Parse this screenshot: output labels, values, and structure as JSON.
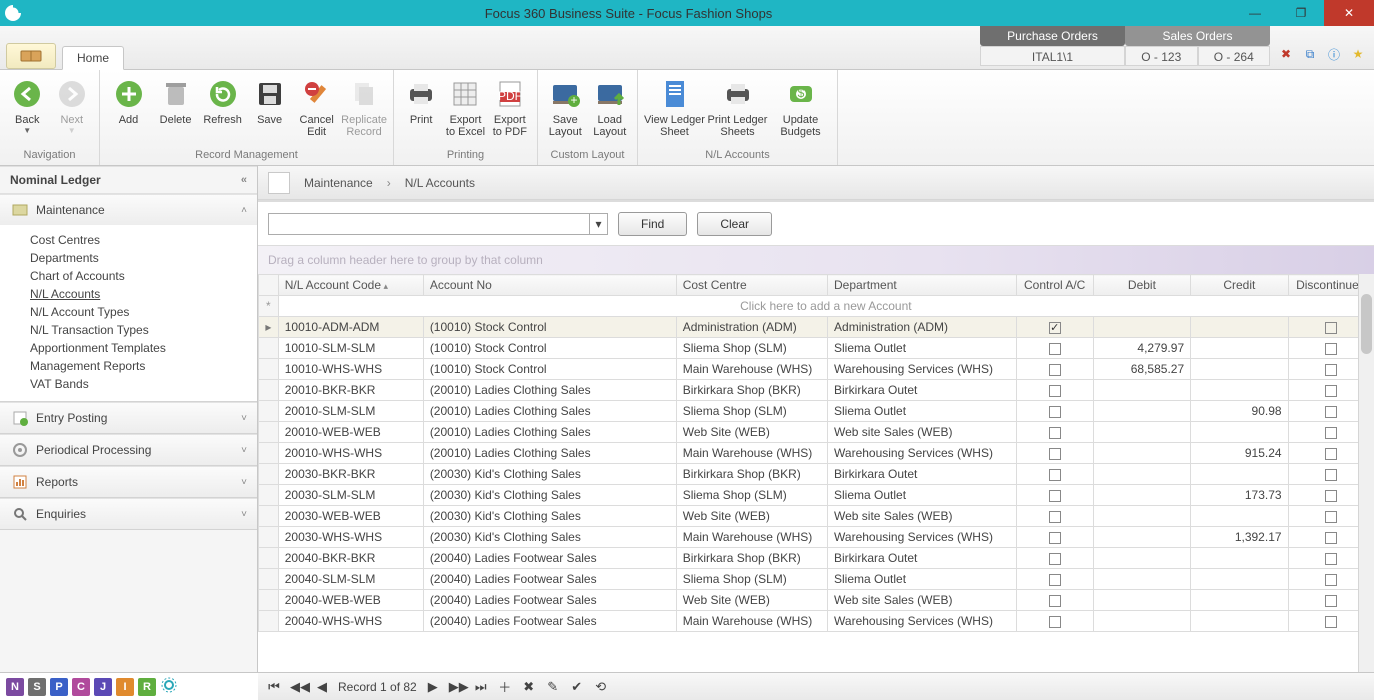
{
  "window": {
    "title": "Focus 360 Business Suite - Focus Fashion Shops"
  },
  "orders": {
    "purchase": {
      "label": "Purchase Orders",
      "cells": [
        "ITAL1\\1"
      ]
    },
    "sales": {
      "label": "Sales Orders",
      "cells": [
        "O - 123",
        "O - 264"
      ]
    }
  },
  "ribbon": {
    "home_tab": "Home",
    "groups": {
      "navigation": {
        "label": "Navigation",
        "back": "Back",
        "next": "Next"
      },
      "record": {
        "label": "Record Management",
        "add": "Add",
        "delete": "Delete",
        "refresh": "Refresh",
        "save": "Save",
        "cancel": "Cancel\nEdit",
        "replicate": "Replicate\nRecord"
      },
      "printing": {
        "label": "Printing",
        "print": "Print",
        "excel": "Export\nto Excel",
        "pdf": "Export\nto PDF"
      },
      "layout": {
        "label": "Custom Layout",
        "save": "Save\nLayout",
        "load": "Load\nLayout"
      },
      "nl": {
        "label": "N/L Accounts",
        "view": "View Ledger\nSheet",
        "print": "Print Ledger\nSheets",
        "update": "Update\nBudgets"
      }
    }
  },
  "sidebar": {
    "title": "Nominal Ledger",
    "sections": {
      "maintenance": {
        "label": "Maintenance",
        "items": [
          "Cost Centres",
          "Departments",
          "Chart of Accounts",
          "N/L Accounts",
          "N/L Account Types",
          "N/L Transaction Types",
          "Apportionment Templates",
          "Management Reports",
          "VAT Bands"
        ],
        "active_index": 3
      },
      "entry": {
        "label": "Entry Posting"
      },
      "periodical": {
        "label": "Periodical Processing"
      },
      "reports": {
        "label": "Reports"
      },
      "enquiries": {
        "label": "Enquiries"
      }
    }
  },
  "breadcrumb": {
    "a": "Maintenance",
    "b": "N/L Accounts"
  },
  "findbar": {
    "find": "Find",
    "clear": "Clear"
  },
  "groupbar": "Drag a column header here to group by that column",
  "grid": {
    "columns": [
      "N/L Account Code",
      "Account No",
      "Cost Centre",
      "Department",
      "Control A/C",
      "Debit",
      "Credit",
      "Discontinued"
    ],
    "addrow_text": "Click here to add a new Account",
    "rows": [
      {
        "code": "10010-ADM-ADM",
        "acc": "(10010) Stock Control",
        "cc": "Administration (ADM)",
        "dept": "Administration (ADM)",
        "ctrl": true,
        "debit": "",
        "credit": "",
        "disc": false,
        "sel": true
      },
      {
        "code": "10010-SLM-SLM",
        "acc": "(10010) Stock Control",
        "cc": "Sliema Shop (SLM)",
        "dept": "Sliema Outlet",
        "ctrl": false,
        "debit": "4,279.97",
        "credit": "",
        "disc": false
      },
      {
        "code": "10010-WHS-WHS",
        "acc": "(10010) Stock Control",
        "cc": "Main Warehouse (WHS)",
        "dept": "Warehousing Services (WHS)",
        "ctrl": false,
        "debit": "68,585.27",
        "credit": "",
        "disc": false
      },
      {
        "code": "20010-BKR-BKR",
        "acc": "(20010) Ladies Clothing Sales",
        "cc": "Birkirkara Shop (BKR)",
        "dept": "Birkirkara Outet",
        "ctrl": false,
        "debit": "",
        "credit": "",
        "disc": false
      },
      {
        "code": "20010-SLM-SLM",
        "acc": "(20010) Ladies Clothing Sales",
        "cc": "Sliema Shop (SLM)",
        "dept": "Sliema Outlet",
        "ctrl": false,
        "debit": "",
        "credit": "90.98",
        "disc": false
      },
      {
        "code": "20010-WEB-WEB",
        "acc": "(20010) Ladies Clothing Sales",
        "cc": "Web Site (WEB)",
        "dept": "Web site Sales (WEB)",
        "ctrl": false,
        "debit": "",
        "credit": "",
        "disc": false
      },
      {
        "code": "20010-WHS-WHS",
        "acc": "(20010) Ladies Clothing Sales",
        "cc": "Main Warehouse (WHS)",
        "dept": "Warehousing Services (WHS)",
        "ctrl": false,
        "debit": "",
        "credit": "915.24",
        "disc": false
      },
      {
        "code": "20030-BKR-BKR",
        "acc": "(20030) Kid's Clothing Sales",
        "cc": "Birkirkara Shop (BKR)",
        "dept": "Birkirkara Outet",
        "ctrl": false,
        "debit": "",
        "credit": "",
        "disc": false
      },
      {
        "code": "20030-SLM-SLM",
        "acc": "(20030) Kid's Clothing Sales",
        "cc": "Sliema Shop (SLM)",
        "dept": "Sliema Outlet",
        "ctrl": false,
        "debit": "",
        "credit": "173.73",
        "disc": false
      },
      {
        "code": "20030-WEB-WEB",
        "acc": "(20030) Kid's Clothing Sales",
        "cc": "Web Site (WEB)",
        "dept": "Web site Sales (WEB)",
        "ctrl": false,
        "debit": "",
        "credit": "",
        "disc": false
      },
      {
        "code": "20030-WHS-WHS",
        "acc": "(20030) Kid's Clothing Sales",
        "cc": "Main Warehouse (WHS)",
        "dept": "Warehousing Services (WHS)",
        "ctrl": false,
        "debit": "",
        "credit": "1,392.17",
        "disc": false
      },
      {
        "code": "20040-BKR-BKR",
        "acc": "(20040) Ladies Footwear Sales",
        "cc": "Birkirkara Shop (BKR)",
        "dept": "Birkirkara Outet",
        "ctrl": false,
        "debit": "",
        "credit": "",
        "disc": false
      },
      {
        "code": "20040-SLM-SLM",
        "acc": "(20040) Ladies Footwear Sales",
        "cc": "Sliema Shop (SLM)",
        "dept": "Sliema Outlet",
        "ctrl": false,
        "debit": "",
        "credit": "",
        "disc": false
      },
      {
        "code": "20040-WEB-WEB",
        "acc": "(20040) Ladies Footwear Sales",
        "cc": "Web Site (WEB)",
        "dept": "Web site Sales (WEB)",
        "ctrl": false,
        "debit": "",
        "credit": "",
        "disc": false
      },
      {
        "code": "20040-WHS-WHS",
        "acc": "(20040) Ladies Footwear Sales",
        "cc": "Main Warehouse (WHS)",
        "dept": "Warehousing Services (WHS)",
        "ctrl": false,
        "debit": "",
        "credit": "",
        "disc": false
      }
    ]
  },
  "navigator": {
    "status": "Record 1 of 82"
  },
  "letters": [
    {
      "t": "N",
      "c": "#7b4aa0"
    },
    {
      "t": "S",
      "c": "#6f6f6f"
    },
    {
      "t": "P",
      "c": "#3a60c7"
    },
    {
      "t": "C",
      "c": "#b04a9c"
    },
    {
      "t": "J",
      "c": "#5b49b5"
    },
    {
      "t": "I",
      "c": "#e08a2e"
    },
    {
      "t": "R",
      "c": "#5fae3e"
    }
  ]
}
